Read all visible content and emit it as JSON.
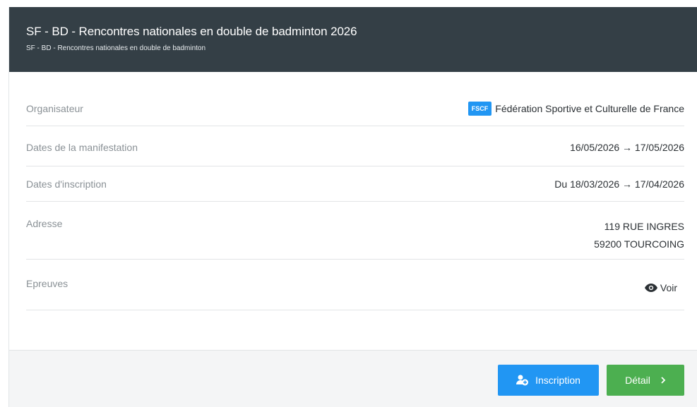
{
  "header": {
    "title": "SF - BD - Rencontres nationales en double de badminton 2026",
    "subtitle": "SF - BD - Rencontres nationales en double de badminton"
  },
  "organisateur": {
    "label": "Organisateur",
    "badge": "FSCF",
    "value": "Fédération Sportive et Culturelle de France"
  },
  "dates_manifestation": {
    "label": "Dates de la manifestation",
    "value": "16/05/2026 → 17/05/2026"
  },
  "dates_inscription": {
    "label": "Dates d'inscription",
    "value": "Du 18/03/2026 → 17/04/2026"
  },
  "adresse": {
    "label": "Adresse",
    "line1": "119 RUE INGRES",
    "line2": "59200 TOURCOING"
  },
  "epreuves": {
    "label": "Epreuves",
    "link": "Voir",
    "icon": "eye-icon"
  },
  "footer": {
    "inscription_label": "Inscription",
    "inscription_icon": "user-add-icon",
    "detail_label": "Détail",
    "detail_icon": "chevron-right-icon"
  },
  "colors": {
    "header_bg": "#343f46",
    "primary": "#2196f3",
    "success": "#4caf50"
  }
}
